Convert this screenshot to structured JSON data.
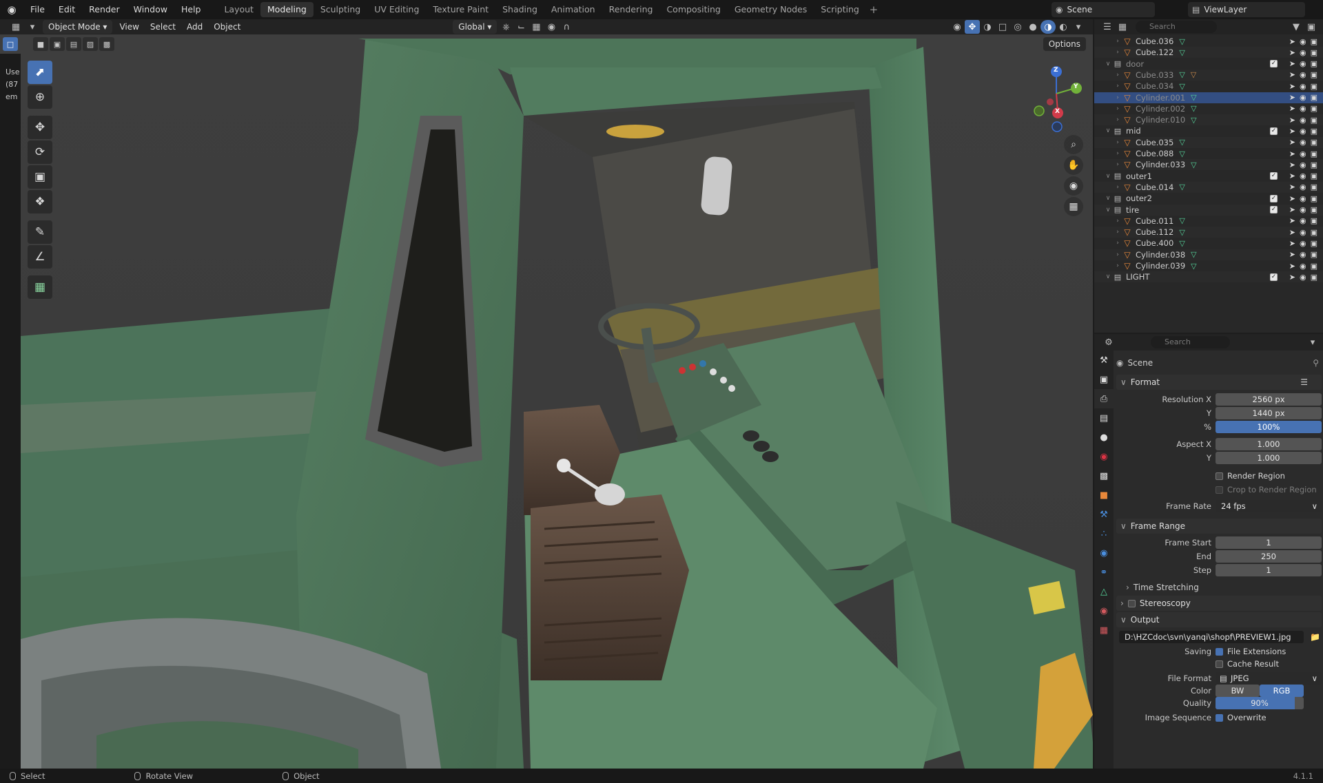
{
  "menus": [
    "File",
    "Edit",
    "Render",
    "Window",
    "Help"
  ],
  "workspaces": [
    {
      "label": "Layout",
      "active": false
    },
    {
      "label": "Modeling",
      "active": true
    },
    {
      "label": "Sculpting",
      "active": false
    },
    {
      "label": "UV Editing",
      "active": false
    },
    {
      "label": "Texture Paint",
      "active": false
    },
    {
      "label": "Shading",
      "active": false
    },
    {
      "label": "Animation",
      "active": false
    },
    {
      "label": "Rendering",
      "active": false
    },
    {
      "label": "Compositing",
      "active": false
    },
    {
      "label": "Geometry Nodes",
      "active": false
    },
    {
      "label": "Scripting",
      "active": false
    }
  ],
  "scene_name": "Scene",
  "view_layer": "ViewLayer",
  "viewport": {
    "mode": "Object Mode",
    "menu": [
      "View",
      "Select",
      "Add",
      "Object"
    ],
    "orientation": "Global",
    "options_label": "Options",
    "overlay_text": [
      "Use",
      "(87",
      "em"
    ]
  },
  "gizmo": {
    "x": "X",
    "y": "Y",
    "z": "Z"
  },
  "outliner": {
    "search_placeholder": "Search",
    "rows": [
      {
        "name": "Cube.036",
        "type": "obj",
        "indent": 2,
        "dim": false,
        "selected": false,
        "mesh": true,
        "mat": false
      },
      {
        "name": "Cube.122",
        "type": "obj",
        "indent": 2,
        "dim": false,
        "selected": false,
        "mesh": true,
        "mat": false
      },
      {
        "name": "door",
        "type": "col",
        "indent": 1,
        "dim": true,
        "selected": false
      },
      {
        "name": "Cube.033",
        "type": "obj",
        "indent": 2,
        "dim": true,
        "selected": false,
        "mesh": true,
        "mat": true
      },
      {
        "name": "Cube.034",
        "type": "obj",
        "indent": 2,
        "dim": true,
        "selected": false,
        "mesh": true,
        "mat": false
      },
      {
        "name": "Cylinder.001",
        "type": "obj",
        "indent": 2,
        "dim": true,
        "selected": true,
        "mesh": true,
        "mat": false
      },
      {
        "name": "Cylinder.002",
        "type": "obj",
        "indent": 2,
        "dim": true,
        "selected": false,
        "mesh": true,
        "mat": false
      },
      {
        "name": "Cylinder.010",
        "type": "obj",
        "indent": 2,
        "dim": true,
        "selected": false,
        "mesh": true,
        "mat": false
      },
      {
        "name": "mid",
        "type": "col",
        "indent": 1,
        "dim": false,
        "selected": false
      },
      {
        "name": "Cube.035",
        "type": "obj",
        "indent": 2,
        "dim": false,
        "selected": false,
        "mesh": true,
        "mat": false
      },
      {
        "name": "Cube.088",
        "type": "obj",
        "indent": 2,
        "dim": false,
        "selected": false,
        "mesh": true,
        "mat": false
      },
      {
        "name": "Cylinder.033",
        "type": "obj",
        "indent": 2,
        "dim": false,
        "selected": false,
        "mesh": true,
        "mat": false
      },
      {
        "name": "outer1",
        "type": "col",
        "indent": 1,
        "dim": false,
        "selected": false
      },
      {
        "name": "Cube.014",
        "type": "obj",
        "indent": 2,
        "dim": false,
        "selected": false,
        "mesh": true,
        "mat": false
      },
      {
        "name": "outer2",
        "type": "col",
        "indent": 1,
        "dim": false,
        "selected": false
      },
      {
        "name": "tire",
        "type": "col",
        "indent": 1,
        "dim": false,
        "selected": false
      },
      {
        "name": "Cube.011",
        "type": "obj",
        "indent": 2,
        "dim": false,
        "selected": false,
        "mesh": true,
        "mat": false
      },
      {
        "name": "Cube.112",
        "type": "obj",
        "indent": 2,
        "dim": false,
        "selected": false,
        "mesh": true,
        "mat": false
      },
      {
        "name": "Cube.400",
        "type": "obj",
        "indent": 2,
        "dim": false,
        "selected": false,
        "mesh": true,
        "mat": false
      },
      {
        "name": "Cylinder.038",
        "type": "obj",
        "indent": 2,
        "dim": false,
        "selected": false,
        "mesh": true,
        "mat": false
      },
      {
        "name": "Cylinder.039",
        "type": "obj",
        "indent": 2,
        "dim": false,
        "selected": false,
        "mesh": true,
        "mat": false
      },
      {
        "name": "LIGHT",
        "type": "col",
        "indent": 1,
        "dim": false,
        "selected": false
      }
    ]
  },
  "properties": {
    "search_placeholder": "Search",
    "context": "Scene",
    "format": {
      "title": "Format",
      "res_x_label": "Resolution X",
      "res_x": "2560 px",
      "res_y_label": "Y",
      "res_y": "1440 px",
      "res_pct_label": "%",
      "res_pct": "100%",
      "aspect_x_label": "Aspect X",
      "aspect_x": "1.000",
      "aspect_y_label": "Y",
      "aspect_y": "1.000",
      "render_region": "Render Region",
      "crop": "Crop to Render Region",
      "frame_rate_label": "Frame Rate",
      "frame_rate": "24 fps"
    },
    "frame_range": {
      "title": "Frame Range",
      "start_label": "Frame Start",
      "start": "1",
      "end_label": "End",
      "end": "250",
      "step_label": "Step",
      "step": "1",
      "time_stretching": "Time Stretching"
    },
    "stereoscopy": "Stereoscopy",
    "output": {
      "title": "Output",
      "path": "D:\\HZCdoc\\svn\\yanqi\\shopf\\PREVIEW1.jpg",
      "saving_label": "Saving",
      "file_extensions": "File Extensions",
      "cache_result": "Cache Result",
      "file_format_label": "File Format",
      "file_format": "JPEG",
      "color_label": "Color",
      "color_bw": "BW",
      "color_rgb": "RGB",
      "quality_label": "Quality",
      "quality": "90%",
      "quality_value": 0.9,
      "image_seq_label": "Image Sequence",
      "overwrite": "Overwrite"
    }
  },
  "status": {
    "select": "Select",
    "rotate": "Rotate View",
    "object": "Object",
    "version": "4.1.1"
  },
  "colors": {
    "accent": "#4772b3",
    "vehicle": "#4f7a5c",
    "seat": "#5a463a",
    "yellow": "#d9a93a"
  }
}
